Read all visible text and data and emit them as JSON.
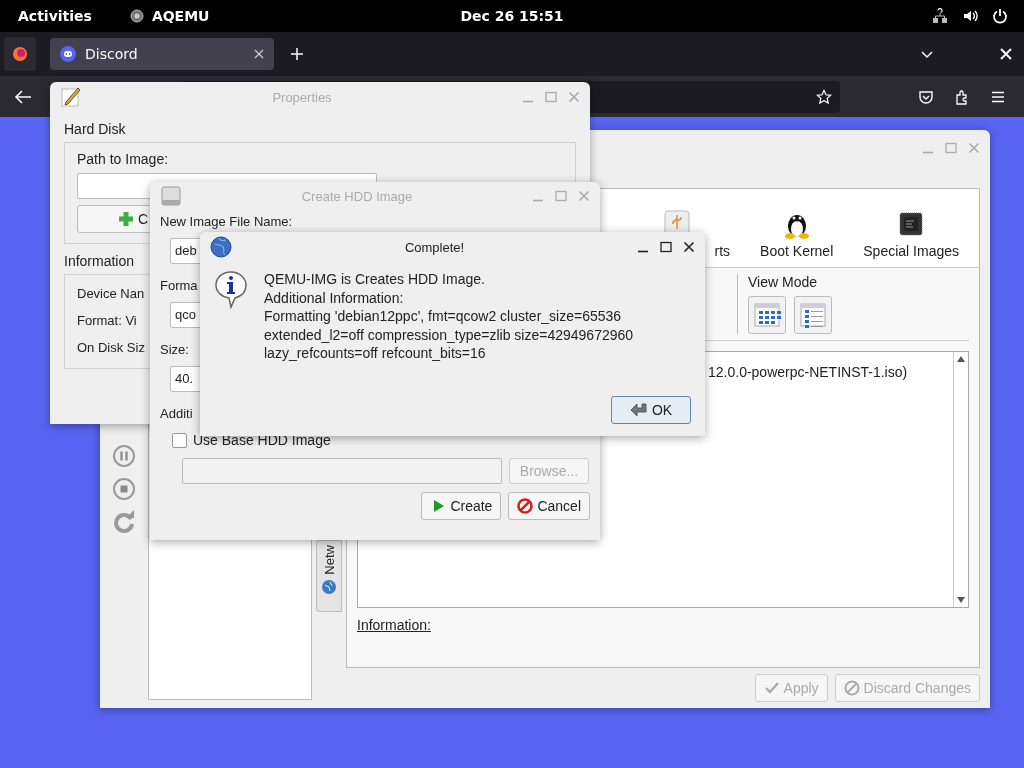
{
  "top_bar": {
    "activities": "Activities",
    "app": "AQEMU",
    "clock": "Dec 26  15:51"
  },
  "browser": {
    "tabs": [
      {
        "label": "Discord",
        "selected": true
      }
    ]
  },
  "main_window": {
    "device_tabs": [
      {
        "label": "rts",
        "kind": "usb"
      },
      {
        "label": "Boot Kernel",
        "kind": "kernel"
      },
      {
        "label": "Special Images",
        "kind": "chip"
      }
    ],
    "view_mode_label": "View Mode",
    "list_item": "12.0.0-powerpc-NETINST-1.iso)",
    "information_label": "Information:",
    "side_tab": "Netw",
    "buttons": [
      {
        "label": "Apply",
        "kind": "apply",
        "disabled": true
      },
      {
        "label": "Discard Changes",
        "kind": "discard",
        "disabled": true
      }
    ]
  },
  "properties_window": {
    "title": "Properties",
    "section": "Hard Disk",
    "path_label": "Path to Image:",
    "create_button": "C",
    "info_section": "Information",
    "info_lines": [
      "Device Nan",
      "Format:  Vi",
      "On Disk Siz"
    ]
  },
  "create_hdd_window": {
    "title": "Create HDD Image",
    "name_label": "New Image File Name:",
    "name_value": "deb",
    "format_label": "Forma",
    "format_value": "qco",
    "size_label": "Size:",
    "size_value": "40.",
    "additional_label": "Additi",
    "use_base": {
      "label": "Use Base HDD Image",
      "checked": false
    },
    "browse": {
      "label": "Browse...",
      "disabled": true
    },
    "buttons": [
      {
        "label": "Create",
        "kind": "create"
      },
      {
        "label": "Cancel",
        "kind": "cancel"
      }
    ]
  },
  "complete_dialog": {
    "title": "Complete!",
    "message": [
      "QEMU-IMG is Creates HDD Image.",
      "Additional Information:",
      "Formatting 'debian12ppc', fmt=qcow2 cluster_size=65536",
      "extended_l2=off compression_type=zlib size=42949672960",
      "lazy_refcounts=off refcount_bits=16"
    ],
    "ok": "OK"
  }
}
